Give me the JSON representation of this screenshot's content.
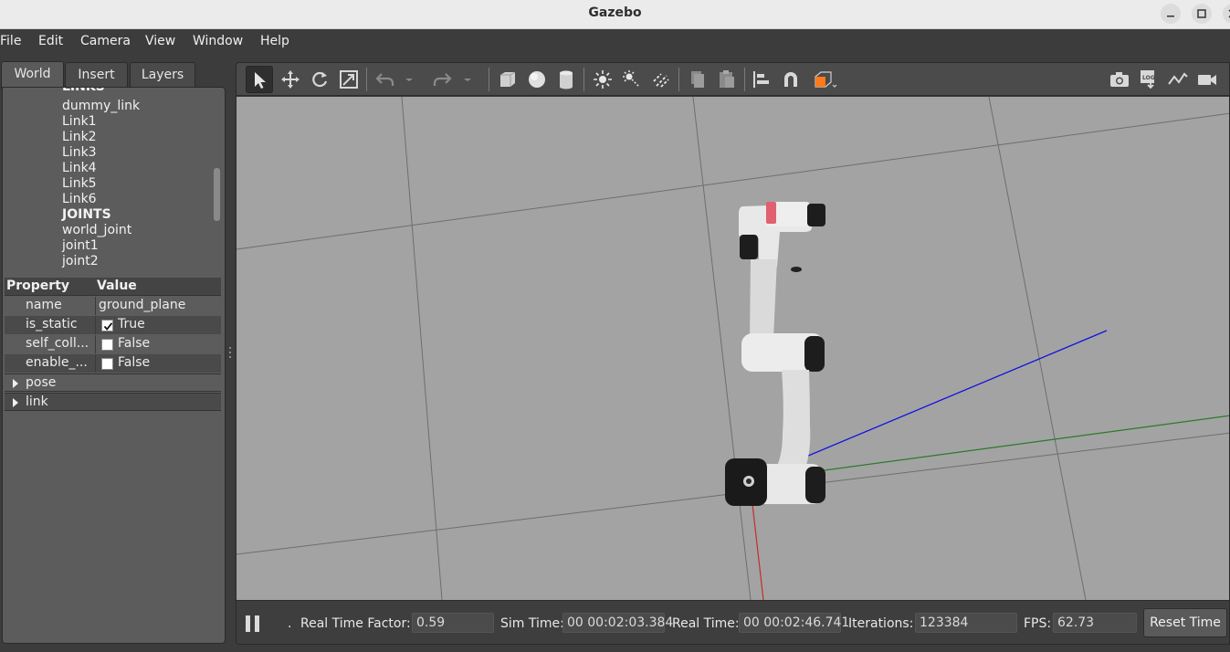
{
  "window": {
    "title": "Gazebo"
  },
  "menu": [
    "File",
    "Edit",
    "Camera",
    "View",
    "Window",
    "Help"
  ],
  "tabs": [
    "World",
    "Insert",
    "Layers"
  ],
  "tree": {
    "partial_top": "LINKS",
    "items": [
      {
        "label": "dummy_link",
        "bold": false
      },
      {
        "label": "Link1",
        "bold": false
      },
      {
        "label": "Link2",
        "bold": false
      },
      {
        "label": "Link3",
        "bold": false
      },
      {
        "label": "Link4",
        "bold": false
      },
      {
        "label": "Link5",
        "bold": false
      },
      {
        "label": "Link6",
        "bold": false
      },
      {
        "label": "JOINTS",
        "bold": true
      },
      {
        "label": "world_joint",
        "bold": false
      },
      {
        "label": "joint1",
        "bold": false
      },
      {
        "label": "joint2",
        "bold": false
      }
    ]
  },
  "properties": {
    "header_property": "Property",
    "header_value": "Value",
    "rows": [
      {
        "name": "name",
        "value": "ground_plane"
      },
      {
        "name": "is_static",
        "value": "True",
        "checked": true
      },
      {
        "name": "self_coll...",
        "value": "False",
        "checked": false
      },
      {
        "name": "enable_...",
        "value": "False",
        "checked": false
      }
    ],
    "groups": [
      "pose",
      "link"
    ]
  },
  "status": {
    "rtf_label": "Real Time Factor:",
    "rtf_value": "0.59",
    "sim_label": "Sim Time:",
    "sim_value": "00 00:02:03.384",
    "real_label": "Real Time:",
    "real_value": "00 00:02:46.741",
    "iter_label": "Iterations:",
    "iter_value": "123384",
    "fps_label": "FPS:",
    "fps_value": "62.73",
    "reset_label": "Reset Time"
  },
  "colors": {
    "viewport_bg": "#a3a3a3",
    "axis_x": "#c0302a",
    "axis_y": "#2a7a2a",
    "axis_z": "#1010e0",
    "grid": "#6e6e6e"
  }
}
